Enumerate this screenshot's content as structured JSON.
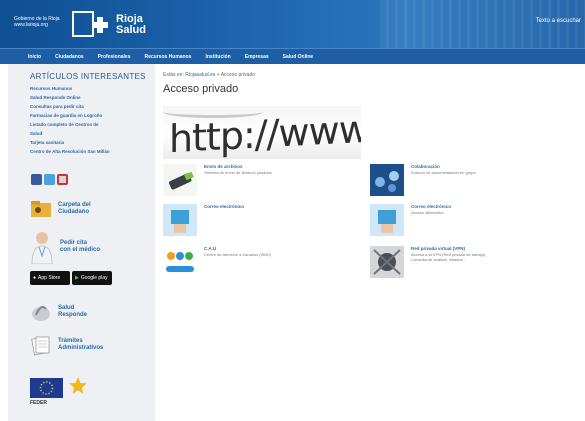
{
  "header": {
    "gov_text_1": "Gobierno de la Rioja",
    "gov_text_2": "www.larioja.org",
    "logo_line1": "Rioja",
    "logo_line2": "Salud",
    "right_text": "Texto a escuchar"
  },
  "nav": {
    "items": [
      "Inicio",
      "Ciudadanos",
      "Profesionales",
      "Recursos Humanos",
      "Institución",
      "Empresas",
      "Salud Online"
    ]
  },
  "sidebar": {
    "title": "ARTÍCULOS INTERESANTES",
    "links": [
      "Recursos Humanos",
      "Salud Responde Online",
      "Consultas para pedir cita",
      "Farmacias de guardia en Logroño",
      "Listado completo de Centros de",
      "Salud",
      "Tarjeta sanitaria",
      "Centro de Alta Resolución San Millán"
    ],
    "social_icons": [
      "facebook-icon",
      "twitter-icon",
      "youtube-icon"
    ],
    "carpeta": [
      "Carpeta del",
      "Ciudadano"
    ],
    "cita": [
      "Pedir cita",
      "con el médico"
    ],
    "app_store": "App Store",
    "google_play": "Google play",
    "salud_responde": [
      "Salud",
      "Responde"
    ],
    "tramites": [
      "Trámites",
      "Administrativos"
    ],
    "feder": "FEDER"
  },
  "main": {
    "breadcrumb_prefix": "Estás en:",
    "breadcrumb_link": "Riojasalud.es",
    "breadcrumb_current": "> Acceso privado",
    "title": "Acceso privado",
    "banner_text": "http://www",
    "services": [
      {
        "title": "Envío de archivos",
        "desc": "Sistema de envío de ficheros pesados"
      },
      {
        "title": "Colaboración",
        "desc": "Entorno de documentación en grupo"
      },
      {
        "title": "Correo electrónico",
        "desc": ""
      },
      {
        "title": "Correo electrónico",
        "desc": "Acceso alternativo"
      },
      {
        "title": "C.A.U",
        "desc": "Centro de Atención a Usuarios (0000)"
      },
      {
        "title": "Red privada virtual (VPN)",
        "desc": "Acceso a la VPN (Red privada de trabajo). Consulta de análisis, listados..."
      }
    ]
  },
  "colors": {
    "header_blue": "#1c64ad",
    "link_blue": "#2b6aa8",
    "sidebar_bg": "#eef0f3"
  }
}
